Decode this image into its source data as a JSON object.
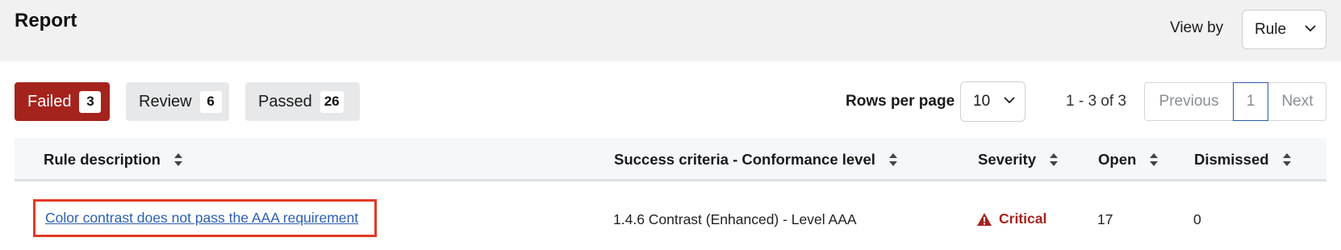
{
  "header": {
    "title": "Report",
    "view_by_label": "View by",
    "view_by_value": "Rule"
  },
  "tabs": [
    {
      "label": "Failed",
      "count": "3",
      "active": true
    },
    {
      "label": "Review",
      "count": "6",
      "active": false
    },
    {
      "label": "Passed",
      "count": "26",
      "active": false
    }
  ],
  "pagination": {
    "rows_per_page_label": "Rows per page",
    "rows_per_page_value": "10",
    "range": "1 - 3 of 3",
    "previous": "Previous",
    "current_page": "1",
    "next": "Next"
  },
  "table": {
    "columns": [
      "Rule description",
      "Success criteria - Conformance level",
      "Severity",
      "Open",
      "Dismissed"
    ],
    "rows": [
      {
        "rule": "Color contrast does not pass the AAA requirement",
        "criteria": "1.4.6 Contrast (Enhanced) - Level AAA",
        "severity": "Critical",
        "open": "17",
        "dismissed": "0"
      }
    ]
  },
  "colors": {
    "failed_tab": "#a5231d",
    "critical": "#a5231d",
    "link": "#2b5fb4",
    "highlight_outline": "#e23a25",
    "pager_active_border": "#2e5aa8"
  },
  "icons": {
    "select_chevron": "chevron-down-icon",
    "column_sort": "sort-icon",
    "severity": "warning-triangle-icon"
  }
}
